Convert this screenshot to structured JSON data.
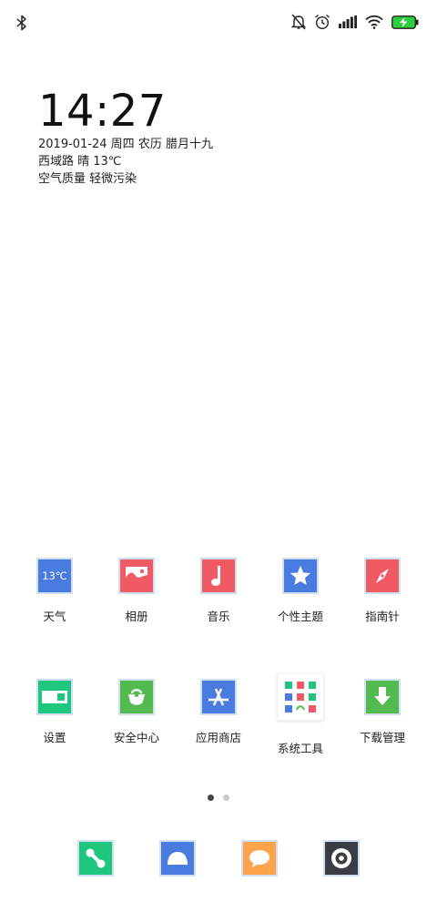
{
  "status_bar": {
    "left_icons": [
      "bluetooth-icon"
    ],
    "right_icons": [
      "bell-muted-icon",
      "alarm-icon",
      "signal-icon",
      "wifi-icon",
      "battery-charging-icon"
    ],
    "battery_color": "#2ecc40"
  },
  "clock_widget": {
    "time": "14:27",
    "date_line": "2019-01-24 周四 农历 腊月十九",
    "weather_line": "西域路 晴 13℃",
    "air_line": "空气质量 轻微污染"
  },
  "apps_row1": [
    {
      "label": "天气",
      "icon": "weather-icon",
      "icon_text": "13℃",
      "color": "#4a7be0"
    },
    {
      "label": "相册",
      "icon": "gallery-icon",
      "color": "#f05a64"
    },
    {
      "label": "音乐",
      "icon": "music-note-icon",
      "color": "#f05a64"
    },
    {
      "label": "个性主题",
      "icon": "star-icon",
      "color": "#4a7be0"
    },
    {
      "label": "指南针",
      "icon": "compass-icon",
      "color": "#f05a64"
    }
  ],
  "apps_row2": [
    {
      "label": "设置",
      "icon": "settings-toggle-icon",
      "color": "#1fc77e"
    },
    {
      "label": "安全中心",
      "icon": "security-bag-icon",
      "color": "#52ba4f"
    },
    {
      "label": "应用商店",
      "icon": "app-store-icon",
      "color": "#4a7be0"
    },
    {
      "label": "系统工具",
      "icon": "folder-icon",
      "color": "#ffffff"
    },
    {
      "label": "下载管理",
      "icon": "download-arrow-icon",
      "color": "#52ba4f"
    }
  ],
  "page_indicator": {
    "pages": 2,
    "active": 0
  },
  "dock": [
    {
      "icon": "phone-icon",
      "color": "#1fc77e"
    },
    {
      "icon": "contacts-icon",
      "color": "#4a7be0"
    },
    {
      "icon": "message-bubble-icon",
      "color": "#ffa24c"
    },
    {
      "icon": "camera-icon",
      "color": "#3a3d44"
    }
  ]
}
